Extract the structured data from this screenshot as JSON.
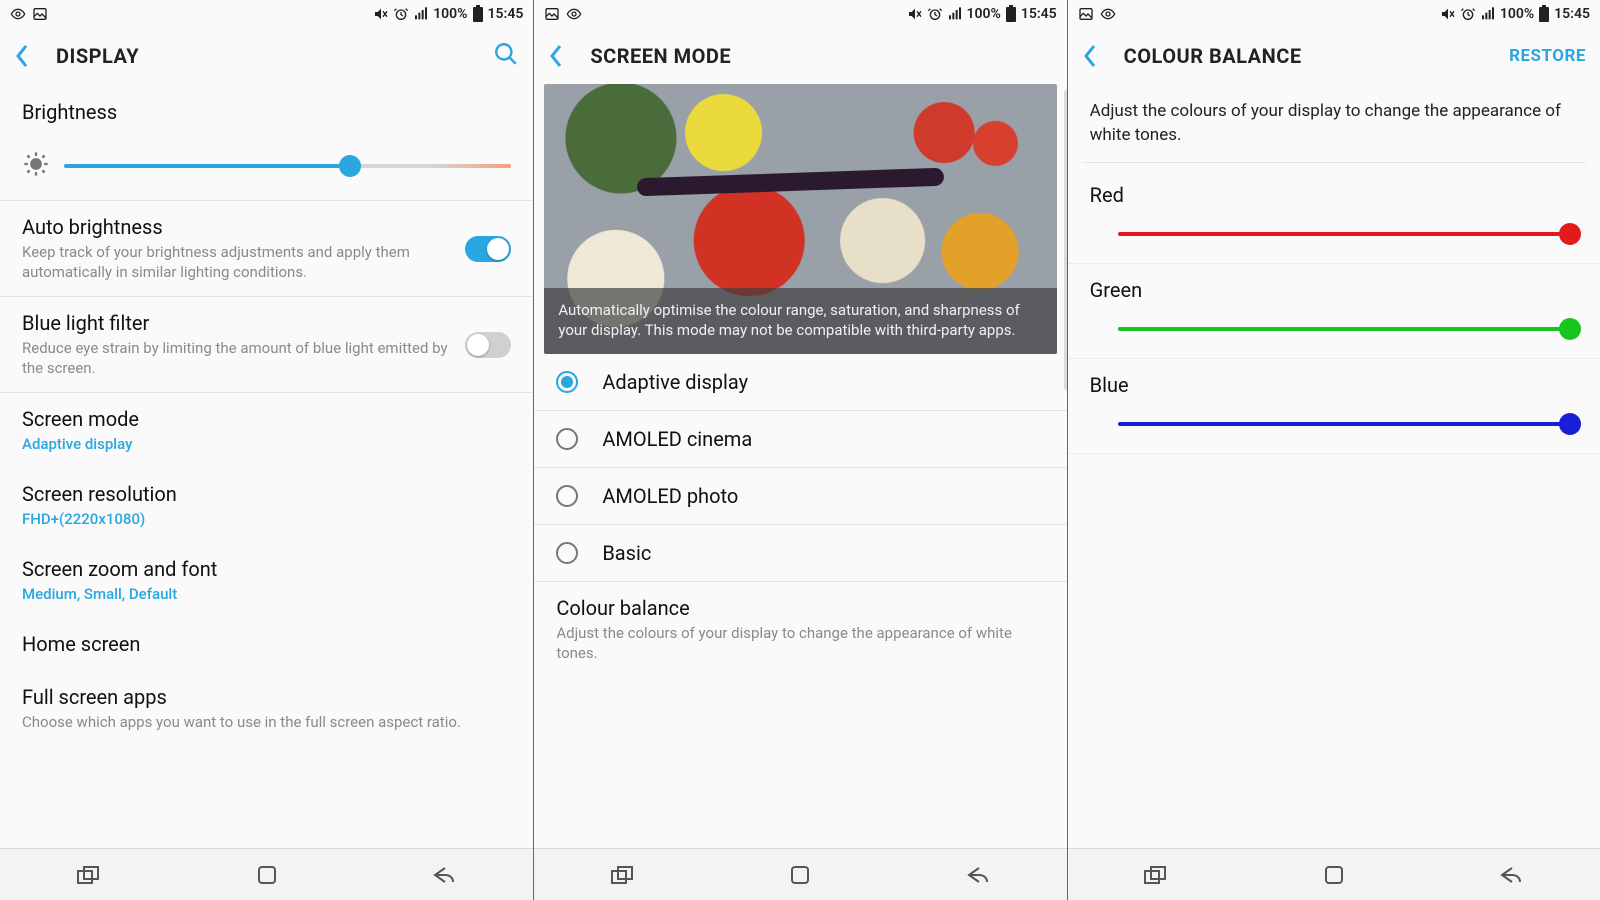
{
  "status": {
    "battery_pct": "100%",
    "time": "15:45"
  },
  "panes": {
    "display": {
      "title": "DISPLAY",
      "brightness_label": "Brightness",
      "brightness_pct": 64,
      "auto_brightness": {
        "title": "Auto brightness",
        "desc": "Keep track of your brightness adjustments and apply them automatically in similar lighting conditions.",
        "enabled": true
      },
      "blue_light": {
        "title": "Blue light filter",
        "desc": "Reduce eye strain by limiting the amount of blue light emitted by the screen.",
        "enabled": false
      },
      "screen_mode": {
        "title": "Screen mode",
        "value": "Adaptive display"
      },
      "screen_res": {
        "title": "Screen resolution",
        "value": "FHD+(2220x1080)"
      },
      "zoom_font": {
        "title": "Screen zoom and font",
        "value": "Medium, Small, Default"
      },
      "home_screen": {
        "title": "Home screen"
      },
      "full_apps": {
        "title": "Full screen apps",
        "desc": "Choose which apps you want to use in the full screen aspect ratio."
      }
    },
    "screen_mode": {
      "title": "SCREEN MODE",
      "preview_caption": "Automatically optimise the colour range, saturation, and sharpness of your display. This mode may not be compatible with third-party apps.",
      "options": [
        {
          "label": "Adaptive display",
          "selected": true
        },
        {
          "label": "AMOLED cinema",
          "selected": false
        },
        {
          "label": "AMOLED photo",
          "selected": false
        },
        {
          "label": "Basic",
          "selected": false
        }
      ],
      "colour_balance": {
        "title": "Colour balance",
        "desc": "Adjust the colours of your display to change the appearance of white tones."
      }
    },
    "colour_balance": {
      "title": "COLOUR BALANCE",
      "restore": "RESTORE",
      "desc": "Adjust the colours of your display to change the appearance of white tones.",
      "channels": [
        {
          "name": "Red",
          "color": "#e11b1b",
          "pct": 100
        },
        {
          "name": "Green",
          "color": "#18c41e",
          "pct": 100
        },
        {
          "name": "Blue",
          "color": "#1720d6",
          "pct": 100
        }
      ]
    }
  },
  "icons": {
    "eye": "eye-icon",
    "picture": "picture-icon",
    "mute": "mute-icon",
    "alarm": "alarm-icon",
    "signal": "signal-icon",
    "battery": "battery-icon",
    "search": "search-icon",
    "back": "back-icon",
    "recent": "recent-apps-icon",
    "home": "home-icon",
    "nav_back": "nav-back-icon",
    "brightness": "brightness-icon"
  }
}
